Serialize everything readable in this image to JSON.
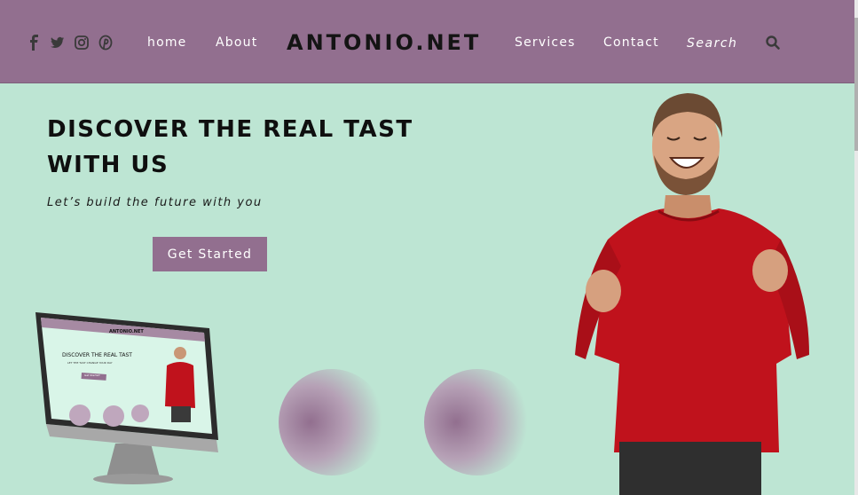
{
  "header": {
    "social": [
      "facebook-icon",
      "twitter-icon",
      "instagram-icon",
      "pinterest-icon"
    ],
    "nav_left": [
      "home",
      "About"
    ],
    "brand": "ANTONIO.NET",
    "nav_right": [
      "Services",
      "Contact"
    ],
    "search_placeholder": "Search"
  },
  "hero": {
    "title_line1": "DISCOVER THE REAL TAST",
    "title_line2": "WITH US",
    "subtitle": "Let’s build the future with you",
    "cta_label": "Get Started"
  },
  "mockup": {
    "brand": "ANTONIO.NET",
    "title": "DISCOVER THE REAL TAST",
    "subtitle": "LET THE TAST CHANGE YOUR DAY",
    "cta_label": "Get Started"
  },
  "colors": {
    "accent": "#926f8f",
    "background": "#bde5d3",
    "brand_text": "#141414",
    "sweater": "#c0121c"
  }
}
